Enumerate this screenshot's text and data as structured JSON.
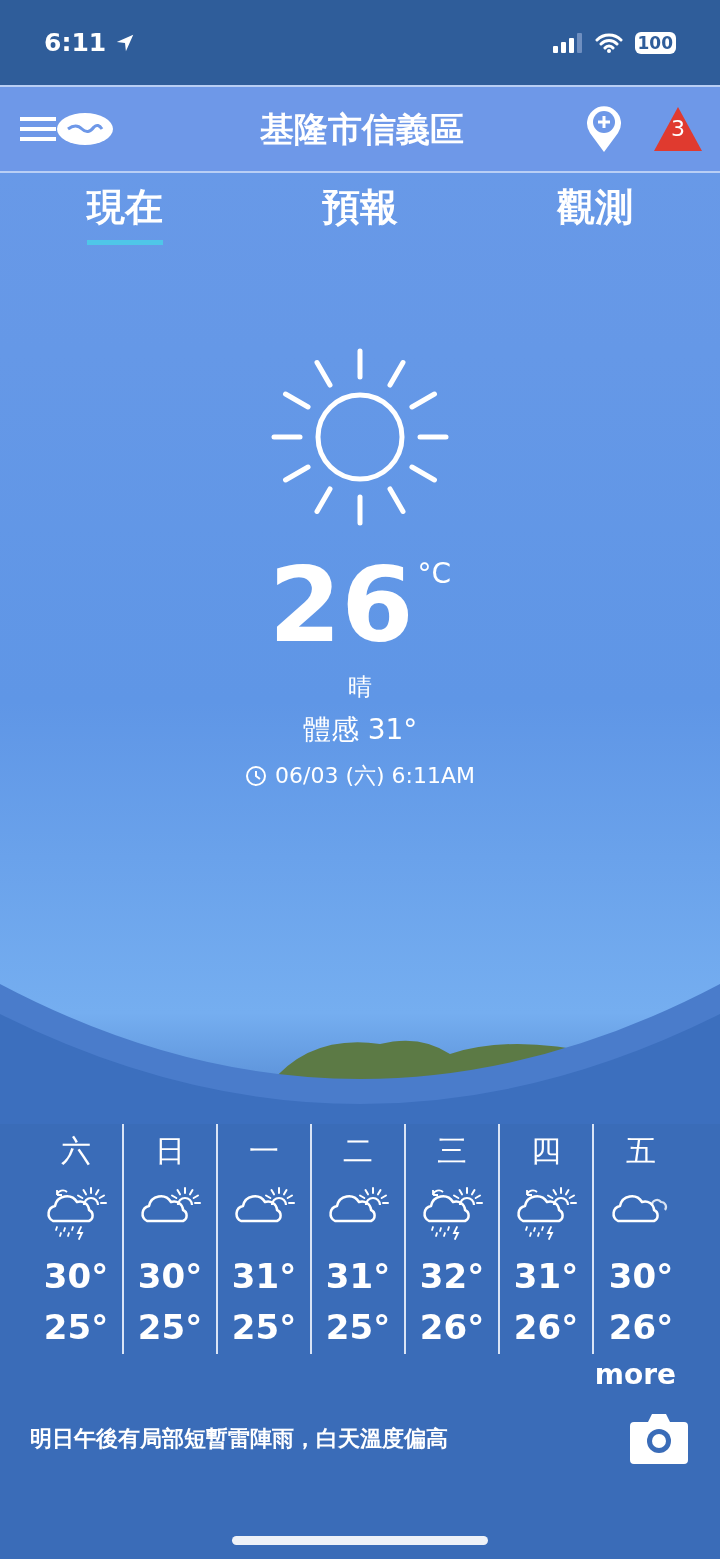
{
  "status_bar": {
    "time": "6:11",
    "battery": "100"
  },
  "header": {
    "title": "基隆市信義區",
    "alert_count": "3"
  },
  "tabs": [
    {
      "label": "現在",
      "selected": true
    },
    {
      "label": "預報",
      "selected": false
    },
    {
      "label": "觀測",
      "selected": false
    }
  ],
  "current": {
    "temperature": "26",
    "unit": "°C",
    "condition": "晴",
    "feels_like": "體感 31°",
    "updated": "06/03 (六) 6:11AM"
  },
  "forecast": [
    {
      "day": "六",
      "kind": "thunder",
      "high": "30°",
      "low": "25°"
    },
    {
      "day": "日",
      "kind": "partly",
      "high": "30°",
      "low": "25°"
    },
    {
      "day": "一",
      "kind": "partly",
      "high": "31°",
      "low": "25°"
    },
    {
      "day": "二",
      "kind": "partly",
      "high": "31°",
      "low": "25°"
    },
    {
      "day": "三",
      "kind": "thunder",
      "high": "32°",
      "low": "26°"
    },
    {
      "day": "四",
      "kind": "thunder",
      "high": "31°",
      "low": "26°"
    },
    {
      "day": "五",
      "kind": "cloudy",
      "high": "30°",
      "low": "26°"
    }
  ],
  "more_link": "more",
  "summary": "明日午後有局部短暫雷陣雨，白天溫度偏高"
}
